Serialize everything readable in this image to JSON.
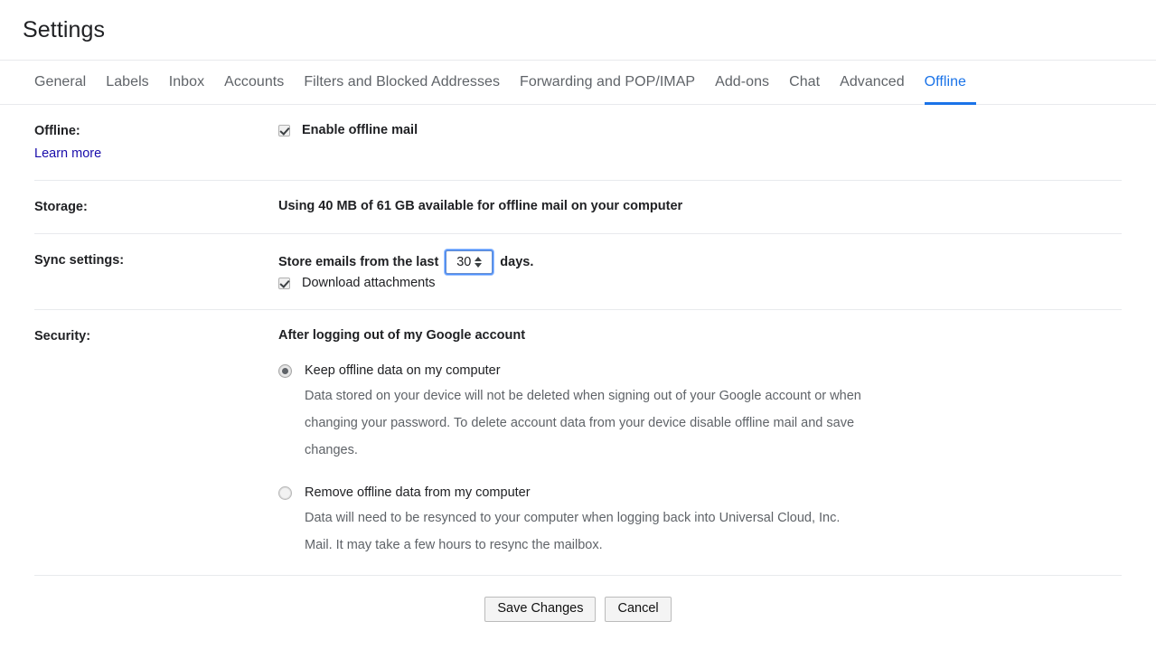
{
  "header": {
    "title": "Settings"
  },
  "tabs": [
    {
      "label": "General",
      "active": false
    },
    {
      "label": "Labels",
      "active": false
    },
    {
      "label": "Inbox",
      "active": false
    },
    {
      "label": "Accounts",
      "active": false
    },
    {
      "label": "Filters and Blocked Addresses",
      "active": false
    },
    {
      "label": "Forwarding and POP/IMAP",
      "active": false
    },
    {
      "label": "Add-ons",
      "active": false
    },
    {
      "label": "Chat",
      "active": false
    },
    {
      "label": "Advanced",
      "active": false
    },
    {
      "label": "Offline",
      "active": true
    }
  ],
  "offline_row": {
    "label": "Offline:",
    "learn_more": "Learn more",
    "enable_label": "Enable offline mail",
    "enable_checked": true
  },
  "storage_row": {
    "label": "Storage:",
    "text": "Using 40 MB of 61 GB available for offline mail on your computer"
  },
  "sync_row": {
    "label": "Sync settings:",
    "prefix": "Store emails from the last",
    "days_value": "30",
    "suffix": "days.",
    "attachments_label": "Download attachments",
    "attachments_checked": true
  },
  "security_row": {
    "label": "Security:",
    "heading": "After logging out of my Google account",
    "options": [
      {
        "title": "Keep offline data on my computer",
        "desc": "Data stored on your device will not be deleted when signing out of your Google account or when changing your password. To delete account data from your device disable offline mail and save changes.",
        "selected": true
      },
      {
        "title": "Remove offline data from my computer",
        "desc": "Data will need to be resynced to your computer when logging back into Universal Cloud, Inc. Mail. It may take a few hours to resync the mailbox.",
        "selected": false
      }
    ]
  },
  "footer": {
    "save_label": "Save Changes",
    "cancel_label": "Cancel"
  },
  "colors": {
    "accent": "#1a73e8",
    "link": "#1a0dab",
    "text": "#202124",
    "muted": "#5f6368",
    "divider": "#e8eaed"
  }
}
